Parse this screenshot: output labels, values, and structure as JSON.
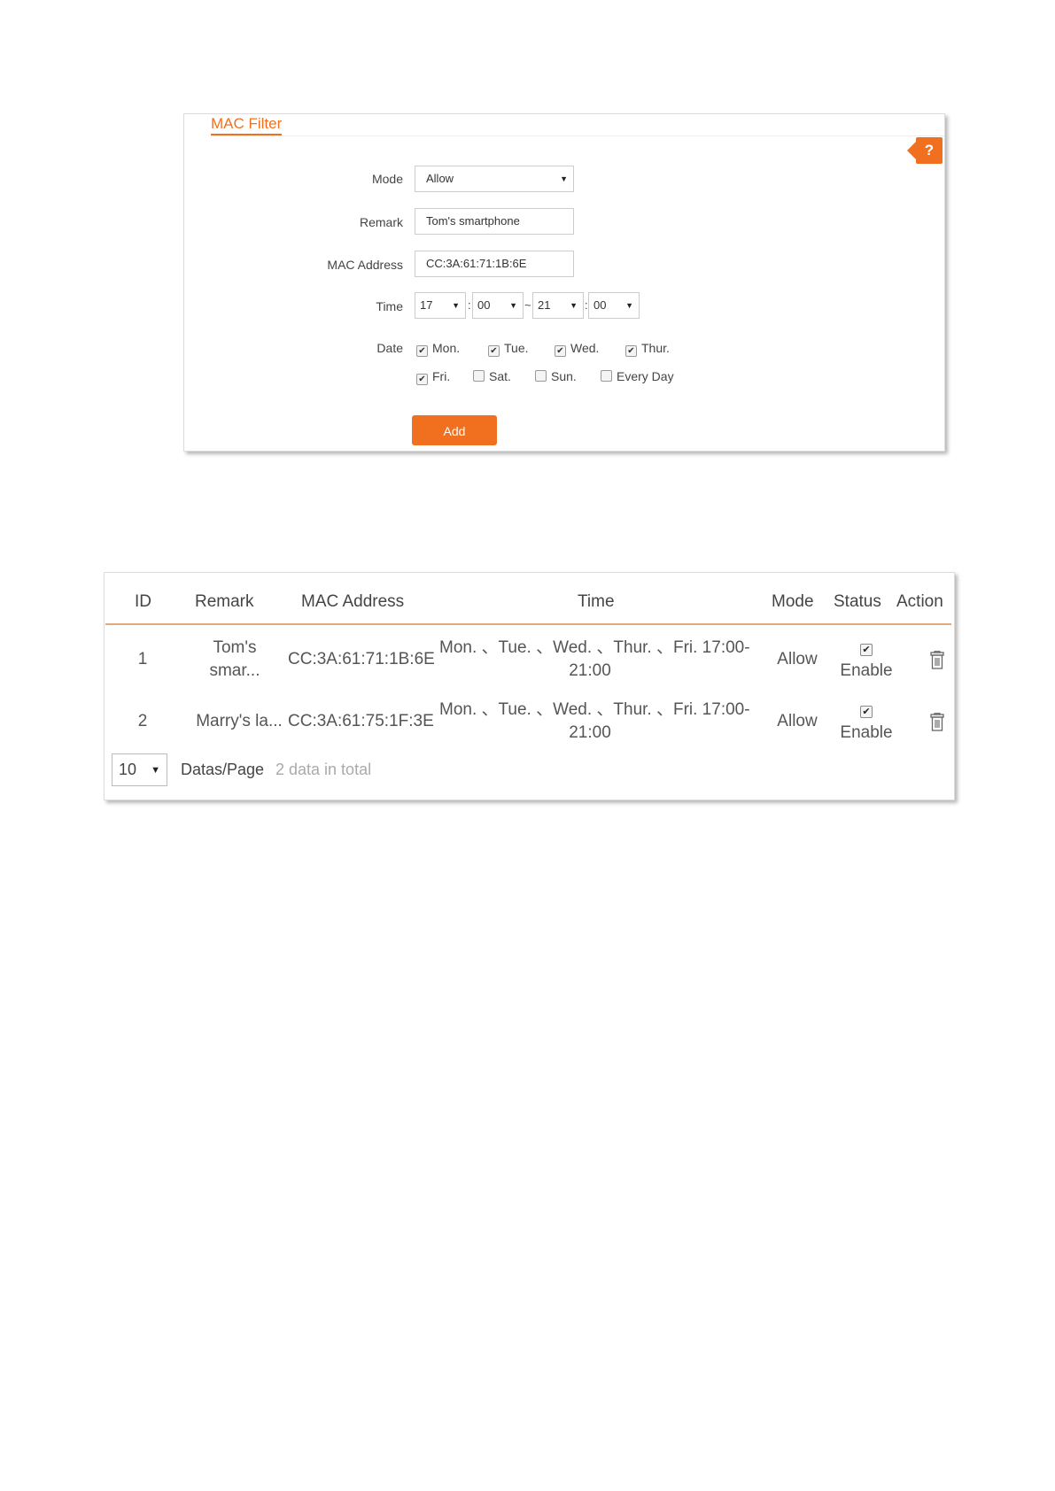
{
  "form": {
    "title": "MAC Filter",
    "help_label": "?",
    "mode_label": "Mode",
    "mode_value": "Allow",
    "remark_label": "Remark",
    "remark_value": "Tom's smartphone",
    "mac_label": "MAC Address",
    "mac_value": "CC:3A:61:71:1B:6E",
    "time_label": "Time",
    "time": {
      "start_hour": "17",
      "start_minute": "00",
      "end_hour": "21",
      "end_minute": "00",
      "colon": ":",
      "tilde": "~"
    },
    "date_label": "Date",
    "days": [
      {
        "label": "Mon.",
        "checked": true
      },
      {
        "label": "Tue.",
        "checked": true
      },
      {
        "label": "Wed.",
        "checked": true
      },
      {
        "label": "Thur.",
        "checked": true
      },
      {
        "label": "Fri.",
        "checked": true
      },
      {
        "label": "Sat.",
        "checked": false
      },
      {
        "label": "Sun.",
        "checked": false
      },
      {
        "label": "Every Day",
        "checked": false
      }
    ],
    "add_label": "Add"
  },
  "table": {
    "headers": {
      "id": "ID",
      "remark": "Remark",
      "mac": "MAC Address",
      "time": "Time",
      "mode": "Mode",
      "status": "Status",
      "action": "Action"
    },
    "rows": [
      {
        "id": "1",
        "remark_line1": "Tom's",
        "remark_line2": "smar...",
        "mac": "CC:3A:61:71:1B:6E",
        "time_line1": "Mon. 、Tue. 、Wed. 、Thur. 、Fri.   17:00-",
        "time_line2": "21:00",
        "mode": "Allow",
        "status_checked": true,
        "status_label": "Enable"
      },
      {
        "id": "2",
        "remark_line1": "Marry's la...",
        "mac": "CC:3A:61:75:1F:3E",
        "time_line1": "Mon. 、Tue. 、Wed. 、Thur. 、Fri.   17:00-",
        "time_line2": "21:00",
        "mode": "Allow",
        "status_checked": true,
        "status_label": "Enable"
      }
    ],
    "page_size": "10",
    "page_size_label": "Datas/Page",
    "total_text": "2 data in total"
  },
  "icons": {
    "dropdown": "chevron-down-icon",
    "checkbox_mark": "✔",
    "delete": "trash-icon"
  },
  "colors": {
    "accent": "#f07020",
    "header_rule": "#e0aa80"
  }
}
